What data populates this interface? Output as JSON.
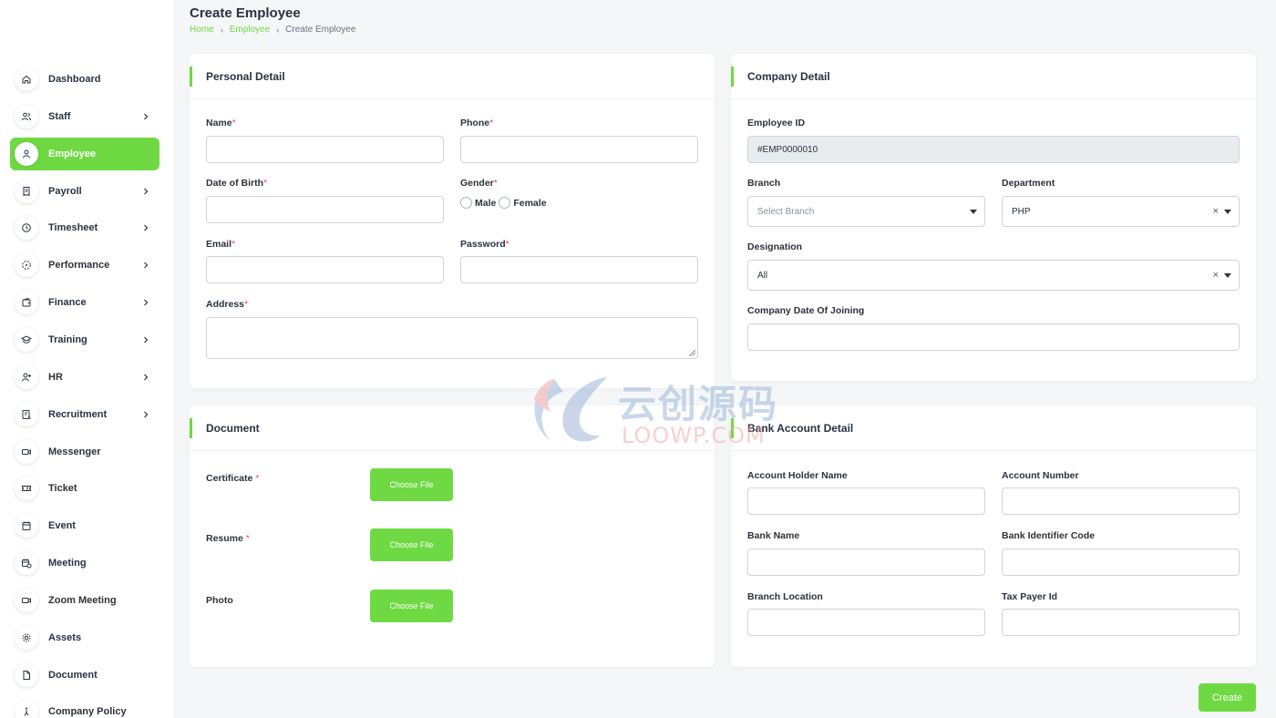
{
  "header": {
    "title": "Create Employee",
    "breadcrumb": [
      "Home",
      "Employee",
      "Create Employee"
    ]
  },
  "sidebar": {
    "items": [
      {
        "label": "Dashboard",
        "icon": "home-icon",
        "chevron": false,
        "active": false
      },
      {
        "label": "Staff",
        "icon": "users-icon",
        "chevron": true,
        "active": false
      },
      {
        "label": "Employee",
        "icon": "user-icon",
        "chevron": false,
        "active": true
      },
      {
        "label": "Payroll",
        "icon": "receipt-icon",
        "chevron": true,
        "active": false
      },
      {
        "label": "Timesheet",
        "icon": "clock-icon",
        "chevron": true,
        "active": false
      },
      {
        "label": "Performance",
        "icon": "performance-icon",
        "chevron": true,
        "active": false
      },
      {
        "label": "Finance",
        "icon": "wallet-icon",
        "chevron": true,
        "active": false
      },
      {
        "label": "Training",
        "icon": "school-icon",
        "chevron": true,
        "active": false
      },
      {
        "label": "HR",
        "icon": "user-plus-icon",
        "chevron": true,
        "active": false
      },
      {
        "label": "Recruitment",
        "icon": "recruitment-icon",
        "chevron": true,
        "active": false
      },
      {
        "label": "Messenger",
        "icon": "video-icon",
        "chevron": false,
        "active": false
      },
      {
        "label": "Ticket",
        "icon": "ticket-icon",
        "chevron": false,
        "active": false
      },
      {
        "label": "Event",
        "icon": "calendar-icon",
        "chevron": false,
        "active": false
      },
      {
        "label": "Meeting",
        "icon": "calendar-time-icon",
        "chevron": false,
        "active": false
      },
      {
        "label": "Zoom Meeting",
        "icon": "video-icon",
        "chevron": false,
        "active": false
      },
      {
        "label": "Assets",
        "icon": "gear-icon",
        "chevron": false,
        "active": false
      },
      {
        "label": "Document",
        "icon": "file-icon",
        "chevron": false,
        "active": false
      },
      {
        "label": "Company Policy",
        "icon": "accessibility-icon",
        "chevron": false,
        "active": false
      }
    ]
  },
  "personal": {
    "title": "Personal Detail",
    "name_label": "Name",
    "phone_label": "Phone",
    "dob_label": "Date of Birth",
    "gender_label": "Gender",
    "gender_options": [
      "Male",
      "Female"
    ],
    "email_label": "Email",
    "password_label": "Password",
    "address_label": "Address",
    "required_mark": "*"
  },
  "company": {
    "title": "Company Detail",
    "employee_id_label": "Employee ID",
    "employee_id_value": "#EMP0000010",
    "branch_label": "Branch",
    "branch_placeholder": "Select Branch",
    "department_label": "Department",
    "department_value": "PHP",
    "designation_label": "Designation",
    "designation_value": "All",
    "doj_label": "Company Date Of Joining",
    "clear_glyph": "×"
  },
  "document": {
    "title": "Document",
    "items": [
      {
        "label": "Certificate",
        "required": "*",
        "button": "Choose File"
      },
      {
        "label": "Resume",
        "required": "*",
        "button": "Choose File"
      },
      {
        "label": "Photo",
        "required": "",
        "button": "Choose File"
      }
    ]
  },
  "bank": {
    "title": "Bank Account Detail",
    "holder_label": "Account Holder Name",
    "number_label": "Account Number",
    "bank_name_label": "Bank Name",
    "bic_label": "Bank Identifier Code",
    "location_label": "Branch Location",
    "tax_label": "Tax Payer Id"
  },
  "actions": {
    "create": "Create"
  },
  "watermark": {
    "cn": "云创源码",
    "en": "LOOWP.COM"
  },
  "colors": {
    "accent": "#6fd943",
    "required": "#ff3a6e",
    "text": "#293240"
  }
}
